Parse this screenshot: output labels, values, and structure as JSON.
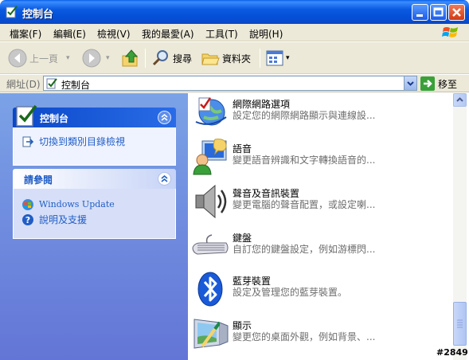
{
  "window": {
    "title": "控制台"
  },
  "menu": {
    "items": [
      "檔案(F)",
      "編輯(E)",
      "檢視(V)",
      "我的最愛(A)",
      "工具(T)",
      "說明(H)"
    ]
  },
  "toolbar": {
    "back_label": "上一頁",
    "search_label": "搜尋",
    "folders_label": "資料夾"
  },
  "address": {
    "label": "網址(D)",
    "value": "控制台",
    "go_label": "移至"
  },
  "taskpane": {
    "panel1": {
      "title": "控制台",
      "links": [
        "切換到類別目錄檢視"
      ]
    },
    "panel2": {
      "title": "請參閱",
      "links": [
        "Windows Update",
        "說明及支援"
      ]
    }
  },
  "items": [
    {
      "name": "網際網路選項",
      "desc": "設定您的網際網路顯示與連線設...",
      "icon": "internet-options-icon"
    },
    {
      "name": "語音",
      "desc": "變更語音辨識和文字轉換語音的...",
      "icon": "speech-icon"
    },
    {
      "name": "聲音及音訊裝置",
      "desc": "變更電腦的聲音配置，或設定喇...",
      "icon": "sound-icon"
    },
    {
      "name": "鍵盤",
      "desc": "自訂您的鍵盤設定，例如游標閃...",
      "icon": "keyboard-icon"
    },
    {
      "name": "藍芽裝置",
      "desc": "設定及管理您的藍芽裝置。",
      "icon": "bluetooth-icon"
    },
    {
      "name": "顯示",
      "desc": "變更您的桌面外觀，例如背景、...",
      "icon": "display-icon"
    }
  ],
  "watermark": "#2849",
  "colors": {
    "title_bar": "#0a5ae0",
    "task_pane": "#7ba2e7",
    "link": "#215dc6"
  }
}
